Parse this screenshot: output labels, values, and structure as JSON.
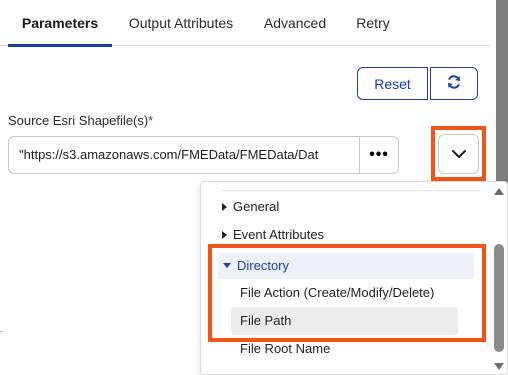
{
  "tabs": [
    {
      "label": "Parameters",
      "active": true
    },
    {
      "label": "Output Attributes",
      "active": false
    },
    {
      "label": "Advanced",
      "active": false
    },
    {
      "label": "Retry",
      "active": false
    }
  ],
  "toolbar": {
    "reset_label": "Reset",
    "refresh_icon": "refresh-icon"
  },
  "field": {
    "label": "Source Esri Shapefile(s)",
    "required_marker": "*",
    "value": "\"https://s3.amazonaws.com/FMEData/FMEData/Dat",
    "browse_label": "•••"
  },
  "dropdown": {
    "toggle_icon": "chevron-down-icon",
    "items": [
      {
        "label": "General",
        "expanded": false
      },
      {
        "label": "Event Attributes",
        "expanded": false
      },
      {
        "label": "Directory",
        "expanded": true,
        "children": [
          {
            "label": "File Action (Create/Modify/Delete)"
          },
          {
            "label": "File Path",
            "selected": true
          },
          {
            "label": "File Root Name"
          }
        ]
      }
    ]
  },
  "colors": {
    "accent": "#1a3fa8",
    "highlight_box": "#f2541b",
    "expanded_bg": "#eef0fa",
    "selected_bg": "#ececec"
  }
}
